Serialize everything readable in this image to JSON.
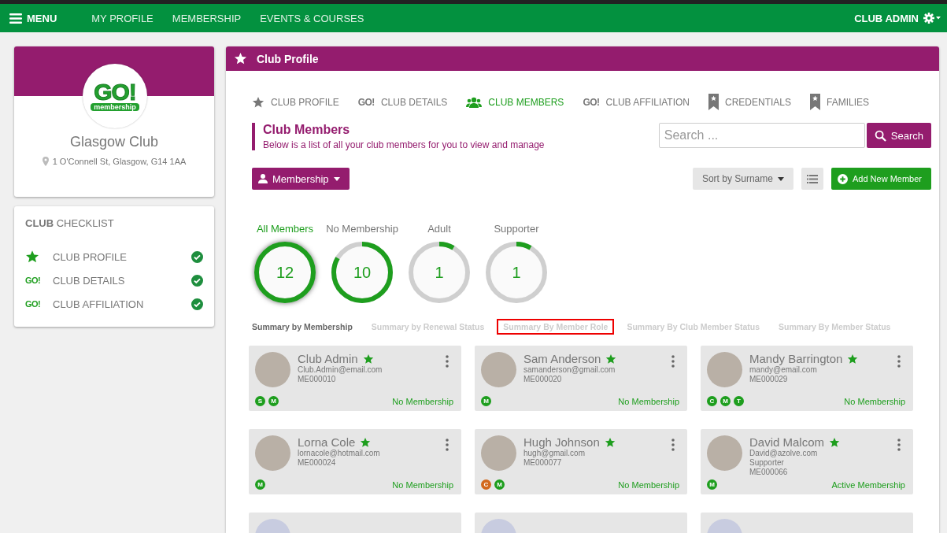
{
  "navbar": {
    "menu_label": "MENU",
    "links": [
      {
        "label": "MY PROFILE"
      },
      {
        "label": "MEMBERSHIP"
      },
      {
        "label": "EVENTS & COURSES"
      }
    ],
    "user_label": "CLUB ADMIN"
  },
  "club_card": {
    "logo": {
      "title": "GO!",
      "subtitle": "membership"
    },
    "name": "Glasgow Club",
    "address": "1 O'Connell St, Glasgow, G14 1AA"
  },
  "checklist": {
    "title": "**CLUB** CHECKLIST",
    "items": [
      {
        "kind": "star",
        "label": "CLUB PROFILE",
        "checked": true
      },
      {
        "kind": "go",
        "icon_text": "GO!",
        "label": "CLUB DETAILS",
        "checked": true
      },
      {
        "kind": "go",
        "icon_text": "GO!",
        "label": "CLUB AFFILIATION",
        "checked": true
      }
    ]
  },
  "panel": {
    "title": "Club Profile",
    "tabs": [
      {
        "kind": "star",
        "label": "CLUB PROFILE",
        "selected": false
      },
      {
        "kind": "go",
        "icon_text": "GO!",
        "label": "CLUB DETAILS",
        "selected": false
      },
      {
        "kind": "people",
        "label": "CLUB MEMBERS",
        "selected": true
      },
      {
        "kind": "go",
        "icon_text": "GO!",
        "label": "CLUB AFFILIATION",
        "selected": false
      },
      {
        "kind": "bookmark",
        "label": "CREDENTIALS",
        "selected": false
      },
      {
        "kind": "bookmark",
        "label": "FAMILIES",
        "selected": false
      }
    ],
    "heading": "Club Members",
    "subheading": "Below is a list of all your club members for you to view and manage",
    "search": {
      "placeholder": "Search ...",
      "button": "Search"
    },
    "filter_button": "Membership",
    "sort_button": "Sort by Surname",
    "add_button": "Add New Member",
    "rings": [
      {
        "label": "All Members",
        "value": "12",
        "level": 1.0,
        "selected": true
      },
      {
        "label": "No Membership",
        "value": "10",
        "level": 0.833,
        "selected": false
      },
      {
        "label": "Adult",
        "value": "1",
        "level": 0.083,
        "selected": false
      },
      {
        "label": "Supporter",
        "value": "1",
        "level": 0.083,
        "selected": false
      }
    ],
    "summary_tabs": [
      {
        "label": "Summary by Membership",
        "selected": true,
        "highlighted": false
      },
      {
        "label": "Summary by Renewal Status",
        "selected": false,
        "highlighted": false
      },
      {
        "label": "Summary By Member Role",
        "selected": false,
        "highlighted": true
      },
      {
        "label": "Summary By Club Member Status",
        "selected": false,
        "highlighted": false
      },
      {
        "label": "Summary By Member Status",
        "selected": false,
        "highlighted": false
      }
    ],
    "members": [
      {
        "kind": "full",
        "name": "Club Admin",
        "email": "Club.Admin@email.com",
        "member_id": "ME000010",
        "badges": [
          {
            "letter": "S",
            "color": "#1e9e1e"
          },
          {
            "letter": "M",
            "color": "#1e9e1e"
          }
        ],
        "status": "No Membership"
      },
      {
        "kind": "full",
        "name": "Sam Anderson",
        "email": "samanderson@gmail.com",
        "member_id": "ME000020",
        "badges": [
          {
            "letter": "M",
            "color": "#1e9e1e"
          }
        ],
        "status": "No Membership"
      },
      {
        "kind": "full",
        "name": "Mandy Barrington",
        "email": "mandy@email.com",
        "member_id": "ME000029",
        "badges": [
          {
            "letter": "C",
            "color": "#1e9e1e"
          },
          {
            "letter": "M",
            "color": "#1e9e1e"
          },
          {
            "letter": "T",
            "color": "#1e9e1e"
          }
        ],
        "status": "No Membership"
      },
      {
        "kind": "full",
        "name": "Lorna Cole",
        "email": "lornacole@hotmail.com",
        "member_id": "ME000024",
        "badges": [
          {
            "letter": "M",
            "color": "#1e9e1e"
          }
        ],
        "status": "No Membership"
      },
      {
        "kind": "full",
        "name": "Hugh Johnson",
        "email": "hugh@gmail.com",
        "member_id": "ME000077",
        "badges": [
          {
            "letter": "C",
            "color": "#d2691e"
          },
          {
            "letter": "M",
            "color": "#1e9e1e"
          }
        ],
        "status": "No Membership"
      },
      {
        "kind": "full",
        "name": "David Malcom",
        "email": "David@azolve.com",
        "role": "Supporter",
        "member_id": "ME000066",
        "badges": [
          {
            "letter": "M",
            "color": "#1e9e1e"
          }
        ],
        "status": "Active Membership"
      },
      {
        "kind": "cut"
      },
      {
        "kind": "cut"
      },
      {
        "kind": "cut"
      }
    ]
  }
}
